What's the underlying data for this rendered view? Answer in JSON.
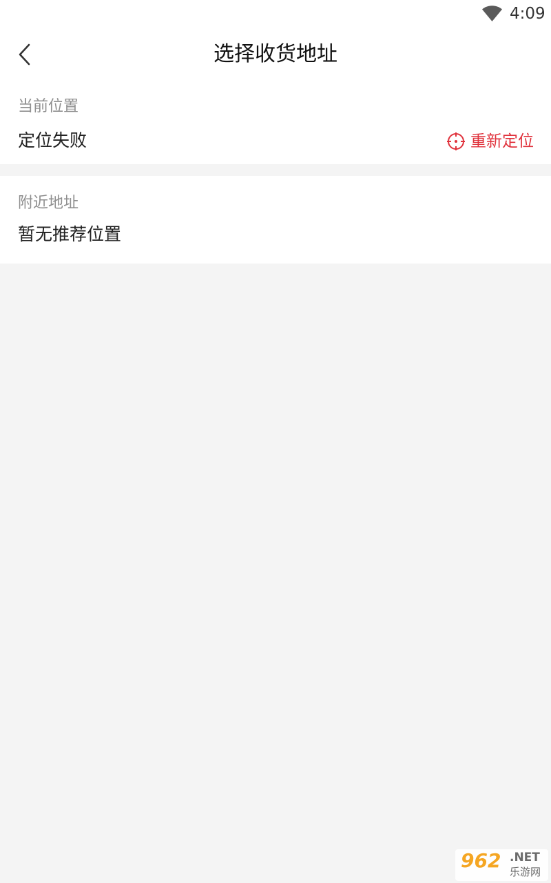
{
  "status_bar": {
    "time": "4:09",
    "wifi_icon": "wifi-icon"
  },
  "nav": {
    "back_icon": "chevron-left-icon",
    "title": "选择收货地址"
  },
  "current_location": {
    "label": "当前位置",
    "value": "定位失败",
    "relocate_icon": "crosshair-icon",
    "relocate_label": "重新定位"
  },
  "nearby": {
    "label": "附近地址",
    "value": "暂无推荐位置"
  },
  "watermark": {
    "number": "962",
    "suffix": ".NET",
    "text": "乐游网"
  },
  "colors": {
    "accent": "#e0323c",
    "background": "#f4f4f4",
    "card": "#ffffff"
  }
}
